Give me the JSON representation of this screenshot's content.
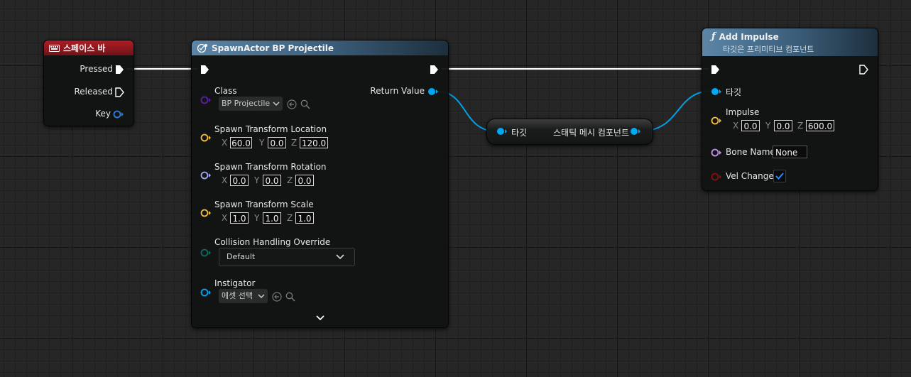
{
  "colors": {
    "exec": "#ffffff",
    "object": "#00a8f4",
    "class": "#5b1fa3",
    "vector": "#f2c03a",
    "rotator": "#a3a8ef",
    "enum": "#0d6b5f",
    "name": "#c88ff0",
    "bool": "#8c0d0d"
  },
  "key_node": {
    "title": "스페이스 바",
    "icon": "keyboard-icon",
    "pins": {
      "pressed": "Pressed",
      "released": "Released",
      "key": "Key"
    }
  },
  "spawn_node": {
    "title": "SpawnActor BP Projectile",
    "icon": "spawn-actor-icon",
    "return_value": "Return Value",
    "class_label": "Class",
    "class_value": "BP Projectile",
    "location_label": "Spawn Transform Location",
    "location": {
      "x": "60.0",
      "y": "0.0",
      "z": "120.0"
    },
    "rotation_label": "Spawn Transform Rotation",
    "rotation": {
      "x": "0.0",
      "y": "0.0",
      "z": "0.0"
    },
    "scale_label": "Spawn Transform Scale",
    "scale": {
      "x": "1.0",
      "y": "1.0",
      "z": "1.0"
    },
    "collision_label": "Collision Handling Override",
    "collision_value": "Default",
    "instigator_label": "Instigator",
    "instigator_value": "에셋 선택"
  },
  "cast_node": {
    "input": "타깃",
    "output": "스태틱 메시 컴포넌트"
  },
  "impulse_node": {
    "title": "Add Impulse",
    "subtitle": "타깃은 프리미티브 컴포넌트",
    "icon": "function-icon",
    "target_label": "타깃",
    "impulse_label": "Impulse",
    "impulse": {
      "x": "0.0",
      "y": "0.0",
      "z": "600.0"
    },
    "bone_label": "Bone Name",
    "bone_value": "None",
    "vel_label": "Vel Change",
    "vel_checked": true
  },
  "axes": {
    "x": "X",
    "y": "Y",
    "z": "Z"
  }
}
